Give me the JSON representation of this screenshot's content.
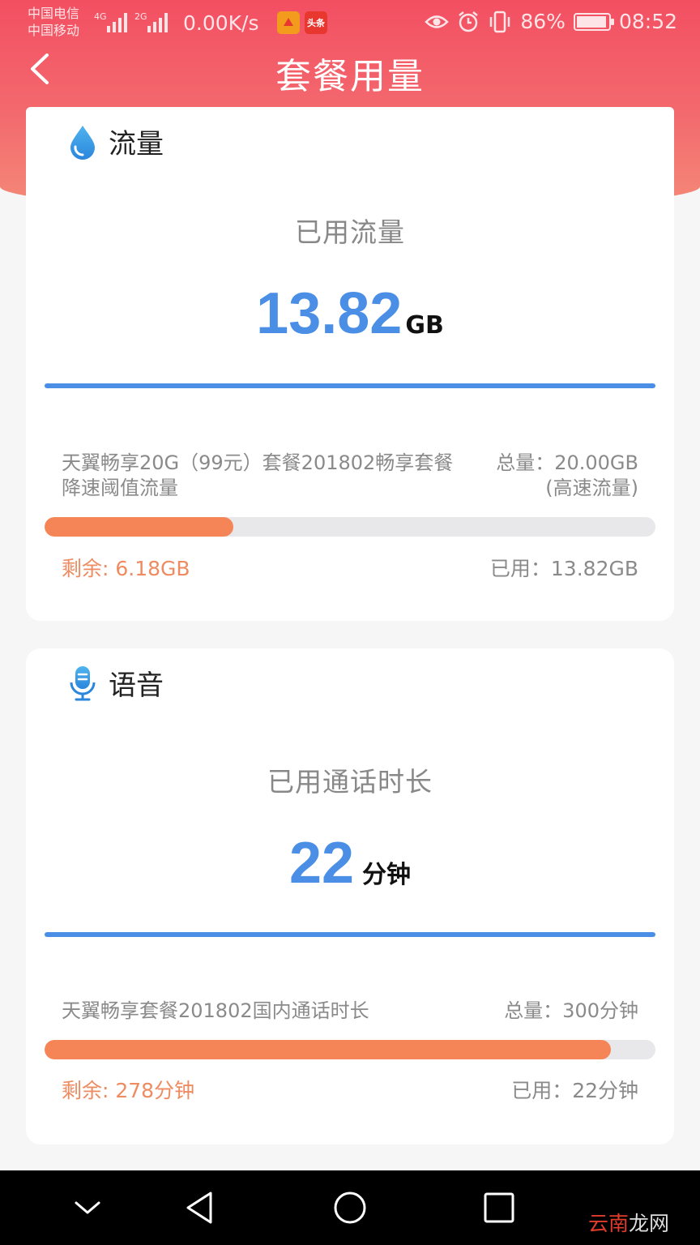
{
  "status_bar": {
    "carrier_1": "中国电信",
    "carrier_2": "中国移动",
    "net_1": "4G",
    "net_2": "2G",
    "speed": "0.00K/s",
    "app_badge_2": "头条",
    "battery": "86%",
    "time": "08:52"
  },
  "header": {
    "title": "套餐用量"
  },
  "data_card": {
    "title": "流量",
    "used_label": "已用流量",
    "used_value": "13.82",
    "used_unit": "GB",
    "plan_name": "天翼畅享20G（99元）套餐201802畅享套餐降速阈值流量",
    "total_line": "总量：20.00GB",
    "total_note": "(高速流量)",
    "progress_fraction": 0.309,
    "remain": "剩余: 6.18GB",
    "used_small": "已用：13.82GB"
  },
  "voice_card": {
    "title": "语音",
    "used_label": "已用通话时长",
    "used_value": "22",
    "used_unit": "分钟",
    "plan_name": "天翼畅享套餐201802国内通话时长",
    "total_line": "总量：300分钟",
    "progress_fraction": 0.927,
    "remain": "剩余: 278分钟",
    "used_small": "已用：22分钟"
  },
  "watermark": {
    "red": "云南",
    "rest": "龙网"
  },
  "colors": {
    "header": "#f34f62",
    "accent_blue": "#4a8ee6",
    "progress": "#f58456",
    "remain_text": "#ee8b60"
  }
}
